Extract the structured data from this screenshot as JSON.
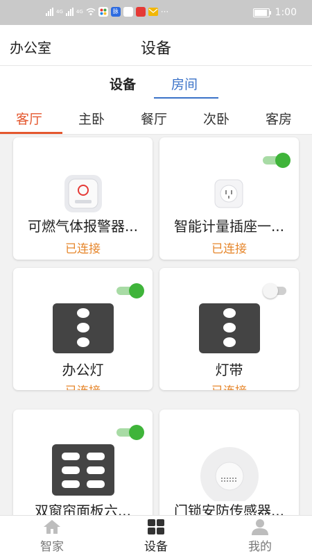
{
  "status_bar": {
    "network_labels": [
      "4G",
      "4G"
    ],
    "app_badges": [
      {
        "label": "脉",
        "color": "#2d6be0"
      },
      {
        "label": "",
        "color": "#e53935"
      },
      {
        "label": "",
        "color": "#f2b705"
      }
    ],
    "more": "···",
    "time": "1:00"
  },
  "header": {
    "location": "办公室",
    "title": "设备"
  },
  "segments": {
    "devices": "设备",
    "rooms": "房间",
    "active": "rooms"
  },
  "room_tabs": [
    {
      "label": "客厅",
      "active": true
    },
    {
      "label": "主卧",
      "active": false
    },
    {
      "label": "餐厅",
      "active": false
    },
    {
      "label": "次卧",
      "active": false
    },
    {
      "label": "客房",
      "active": false
    }
  ],
  "devices": [
    {
      "name": "可燃气体报警器...",
      "status": "已连接",
      "toggle": null,
      "icon": "gas-alarm-icon"
    },
    {
      "name": "智能计量插座一...",
      "status": "已连接",
      "toggle": "on",
      "icon": "smart-socket-icon"
    },
    {
      "name": "办公灯",
      "status": "已连接",
      "toggle": "on",
      "icon": "light-switch-icon"
    },
    {
      "name": "灯带",
      "status": "已连接",
      "toggle": "off",
      "icon": "light-switch-icon"
    },
    {
      "name": "双窗帘面板六...",
      "status": "",
      "toggle": "on",
      "icon": "curtain-panel-icon"
    },
    {
      "name": "门锁安防传感器...",
      "status": "",
      "toggle": null,
      "icon": "door-sensor-icon"
    }
  ],
  "bottom_nav": [
    {
      "label": "智家",
      "icon": "home-icon",
      "active": false
    },
    {
      "label": "设备",
      "icon": "devices-grid-icon",
      "active": true
    },
    {
      "label": "我的",
      "icon": "profile-icon",
      "active": false
    }
  ],
  "colors": {
    "accent_blue": "#3a72c8",
    "tab_active": "#e4572e",
    "status_orange": "#e6862b",
    "toggle_on": "#3fb43a"
  }
}
